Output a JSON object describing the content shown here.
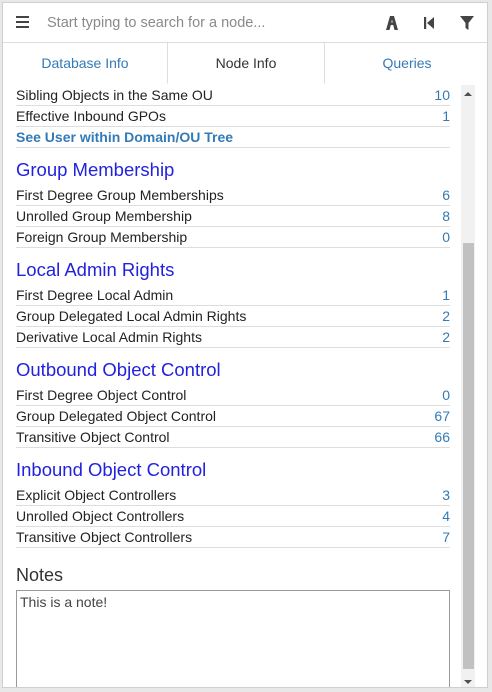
{
  "search": {
    "placeholder": "Start typing to search for a node..."
  },
  "toolbar": {
    "icons": [
      "menu-icon",
      "pathfinding-icon",
      "back-icon",
      "filter-icon"
    ]
  },
  "tabs": [
    {
      "label": "Database Info",
      "active": false
    },
    {
      "label": "Node Info",
      "active": true
    },
    {
      "label": "Queries",
      "active": false
    }
  ],
  "top_rows": [
    {
      "label": "Sibling Objects in the Same OU",
      "value": "10"
    },
    {
      "label": "Effective Inbound GPOs",
      "value": "1"
    }
  ],
  "top_link": "See User within Domain/OU Tree",
  "sections": [
    {
      "title": "Group Membership",
      "rows": [
        {
          "label": "First Degree Group Memberships",
          "value": "6"
        },
        {
          "label": "Unrolled Group Membership",
          "value": "8"
        },
        {
          "label": "Foreign Group Membership",
          "value": "0"
        }
      ]
    },
    {
      "title": "Local Admin Rights",
      "rows": [
        {
          "label": "First Degree Local Admin",
          "value": "1"
        },
        {
          "label": "Group Delegated Local Admin Rights",
          "value": "2"
        },
        {
          "label": "Derivative Local Admin Rights",
          "value": "2"
        }
      ]
    },
    {
      "title": "Outbound Object Control",
      "rows": [
        {
          "label": "First Degree Object Control",
          "value": "0"
        },
        {
          "label": "Group Delegated Object Control",
          "value": "67"
        },
        {
          "label": "Transitive Object Control",
          "value": "66"
        }
      ]
    },
    {
      "title": "Inbound Object Control",
      "rows": [
        {
          "label": "Explicit Object Controllers",
          "value": "3"
        },
        {
          "label": "Unrolled Object Controllers",
          "value": "4"
        },
        {
          "label": "Transitive Object Controllers",
          "value": "7"
        }
      ]
    }
  ],
  "notes": {
    "title": "Notes",
    "value": "This is a note!"
  },
  "colors": {
    "link": "#337ab7",
    "section_title": "#2222dd"
  }
}
